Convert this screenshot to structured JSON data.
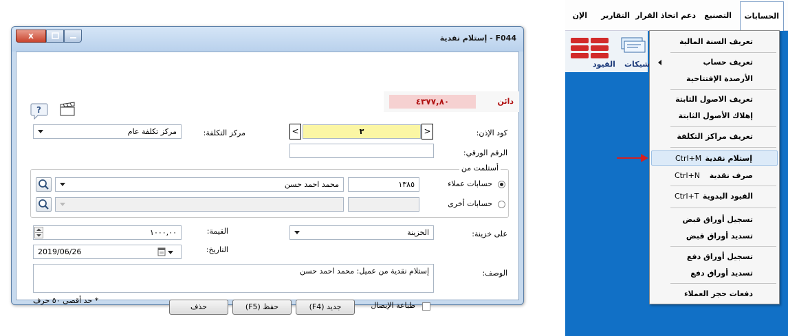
{
  "dialog": {
    "title": "F044 - إستلام نقدية",
    "credit_label": "دائن",
    "credit_value": "٤٣٧٧,٨٠",
    "permit_code_label": "كود الإذن:",
    "permit_code_value": "٣",
    "nav_prev": "<",
    "nav_next": ">",
    "paper_number_label": "الرقم الورقي:",
    "paper_number_value": "",
    "cost_center_label": "مركز التكلفة:",
    "cost_center_value": "مركز تكلفة عام",
    "received_from_caption": "أستلمت من",
    "customers_accounts_label": "حسابات عملاء",
    "customer_code": "١٣٨٥",
    "customer_name": "محمد احمد حسن",
    "other_accounts_label": "حسابات أخرى",
    "other_code": "",
    "other_name": "",
    "treasury_label": "على خزينة:",
    "treasury_value": "الخزينة",
    "amount_label": "القيمة:",
    "amount_value": "١٠٠٠,٠٠",
    "date_label": "التاريخ:",
    "date_value": "2019/06/26",
    "description_label": "الوصف:",
    "description_value": "إستلام نقدية من عميل: محمد احمد حسن",
    "print_receipt_label": "طباعة الإيصال",
    "new_button": "جديد (F4)",
    "save_button": "حفظ (F5)",
    "delete_button": "حذف",
    "max_chars_note": "* حد أقصى ٥٠ حرف",
    "close_glyph": "x"
  },
  "menubar": {
    "items": [
      "الحسابات",
      "التصنيع",
      "دعم اتخاذ القرار",
      "التقارير",
      "الإن"
    ]
  },
  "toolbar": {
    "qiyud": "القيود",
    "cheques": "لشيكات"
  },
  "menu": {
    "items": [
      {
        "label": "تعريف السنة المالية",
        "shortcut": ""
      },
      {
        "label": "تعريف حساب",
        "shortcut": ""
      },
      {
        "label": "الأرصدة الإفتتاحية",
        "shortcut": ""
      },
      {
        "label": "تعريف الاصول الثابتة",
        "shortcut": ""
      },
      {
        "label": "إهلاك الأصول الثابتة",
        "shortcut": ""
      },
      {
        "label": "تعريف مراكز التكلفة",
        "shortcut": ""
      },
      {
        "label": "إستلام نقدية",
        "shortcut": "Ctrl+M"
      },
      {
        "label": "صرف نقدية",
        "shortcut": "Ctrl+N"
      },
      {
        "label": "القيود اليدوية",
        "shortcut": "Ctrl+T"
      },
      {
        "label": "تسجيل أوراق قبض",
        "shortcut": ""
      },
      {
        "label": "تسديد أوراق قبض",
        "shortcut": ""
      },
      {
        "label": "تسجيل أوراق دفع",
        "shortcut": ""
      },
      {
        "label": "تسديد أوراق دفع",
        "shortcut": ""
      },
      {
        "label": "دفعات حجز العملاء",
        "shortcut": ""
      }
    ]
  },
  "colors": {
    "desktop": "#1170c6",
    "highlight": "#dceaf8",
    "credit_text": "#b01010",
    "credit_bg": "#f6d1d1",
    "permit_bg": "#fbf6a4",
    "pointer": "#d42020"
  }
}
